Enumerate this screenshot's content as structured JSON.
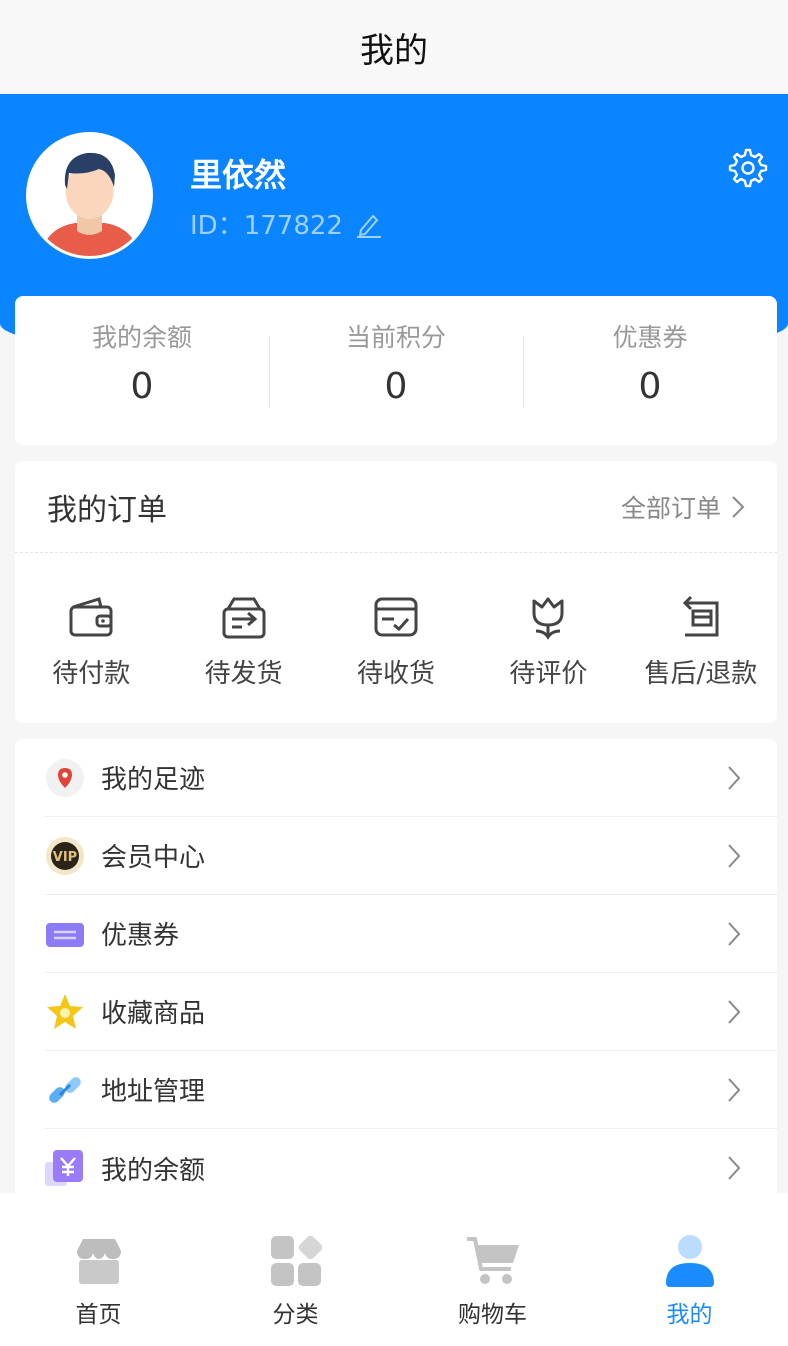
{
  "header": {
    "title": "我的"
  },
  "profile": {
    "name": "里依然",
    "id_text": "ID：177822"
  },
  "stats": [
    {
      "label": "我的余额",
      "value": "0"
    },
    {
      "label": "当前积分",
      "value": "0"
    },
    {
      "label": "优惠券",
      "value": "0"
    }
  ],
  "orders": {
    "title": "我的订单",
    "all_label": "全部订单",
    "items": [
      {
        "label": "待付款",
        "icon": "wallet-icon"
      },
      {
        "label": "待发货",
        "icon": "box-arrow-icon"
      },
      {
        "label": "待收货",
        "icon": "box-check-icon"
      },
      {
        "label": "待评价",
        "icon": "tulip-icon"
      },
      {
        "label": "售后/退款",
        "icon": "return-box-icon"
      }
    ]
  },
  "menu": [
    {
      "label": "我的足迹",
      "icon": "location-icon"
    },
    {
      "label": "会员中心",
      "icon": "vip-icon"
    },
    {
      "label": "优惠券",
      "icon": "coupon-icon"
    },
    {
      "label": "收藏商品",
      "icon": "star-icon"
    },
    {
      "label": "地址管理",
      "icon": "link-icon"
    },
    {
      "label": "我的余额",
      "icon": "yuan-icon"
    }
  ],
  "tabbar": [
    {
      "label": "首页",
      "icon": "store-icon"
    },
    {
      "label": "分类",
      "icon": "category-icon"
    },
    {
      "label": "购物车",
      "icon": "cart-icon"
    },
    {
      "label": "我的",
      "icon": "user-icon",
      "active": true
    }
  ],
  "colors": {
    "accent": "#0a84ff",
    "tab_active": "#1a8cff"
  }
}
